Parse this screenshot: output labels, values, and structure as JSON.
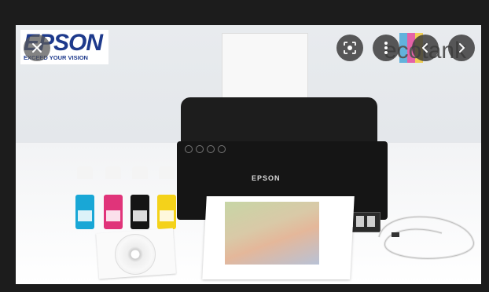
{
  "viewer": {
    "brand_logo_text": "EPSON",
    "brand_tagline": "EXCEED YOUR VISION",
    "product_line_text": "ecotank",
    "printer_label": "EPSON",
    "controls": {
      "close": "close-icon",
      "lens": "google-lens-icon",
      "more": "more-vert-icon",
      "prev": "chevron-left-icon",
      "next": "chevron-right-icon"
    },
    "ink_colors": [
      "#19a7d6",
      "#e0347a",
      "#151515",
      "#f4d21a"
    ],
    "accent": "#1e3a8c"
  }
}
